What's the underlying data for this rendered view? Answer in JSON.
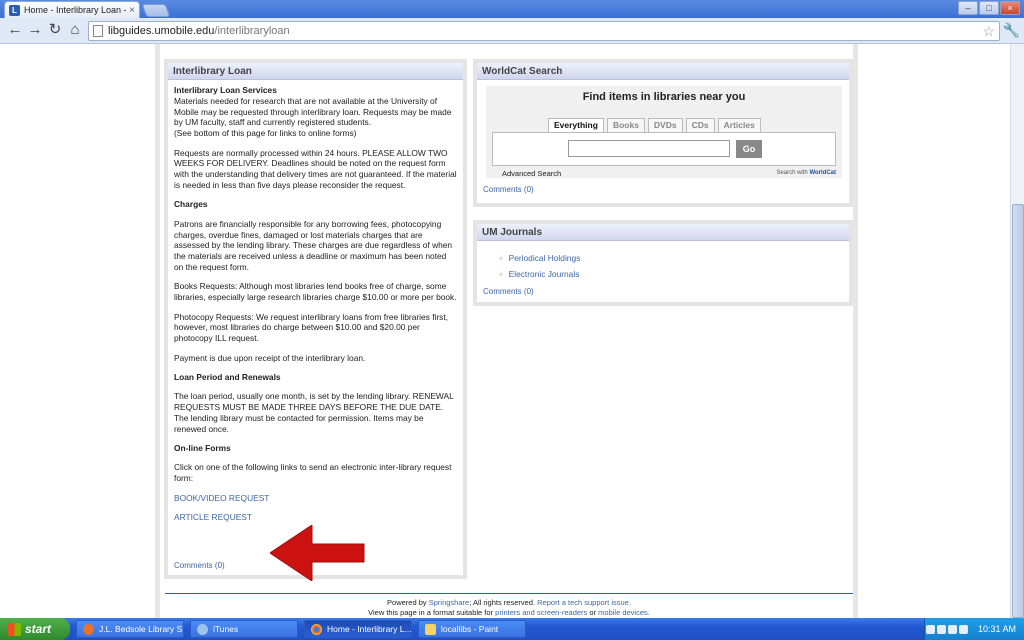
{
  "browser": {
    "tab_title": "Home - Interlibrary Loan - Lib",
    "tab_favicon": "L",
    "tab_close": "×",
    "url_host": "libguides.umobile.edu",
    "url_path": "/interlibraryloan",
    "window_buttons": {
      "minimize": "–",
      "maximize": "□",
      "close": "×"
    }
  },
  "ill": {
    "title": "Interlibrary Loan",
    "services_heading": "Interlibrary Loan Services",
    "services_text": "Materials needed for research that are not available at the University of Mobile may be requested through interlibrary loan. Requests may be made by UM faculty, staff and currently registered students.",
    "services_note": "(See bottom of this page for links to online forms)",
    "processing_text": "Requests are normally processed within 24 hours. PLEASE ALLOW TWO WEEKS FOR DELIVERY. Deadlines should be noted on the request form with the understanding that delivery times are not guaranteed. If the material is needed in less than five days please reconsider the request.",
    "charges_heading": "Charges",
    "charges_text": "Patrons are financially responsible for any borrowing fees, photocopying charges, overdue fines, damaged or lost materials charges that are assessed by the lending library. These charges are due regardless of when the materials are received unless a deadline or maximum has been noted on the request form.",
    "books_text": "Books Requests: Although most libraries lend books free of charge, some libraries, especially large research libraries charge $10.00 or more per book.",
    "photocopy_text": "Photocopy Requests: We request interlibrary loans from free libraries first, however, most libraries do charge between $10.00 and $20.00 per photocopy ILL request.",
    "payment_text": "Payment is due upon receipt of the interlibrary loan.",
    "loan_heading": "Loan Period and Renewals",
    "loan_text": "The loan period, usually one month, is set by the lending library. RENEWAL REQUESTS MUST BE MADE THREE DAYS BEFORE THE DUE DATE. The lending library must be contacted for permission. Items may be renewed once.",
    "forms_heading": "On-line Forms",
    "forms_text": "Click on one of the following links to send an electronic inter-library request form:",
    "book_link": "BOOK/VIDEO REQUEST",
    "article_link": "ARTICLE REQUEST",
    "comments": "Comments (0)"
  },
  "worldcat": {
    "title": "WorldCat Search",
    "heading": "Find items in libraries near you",
    "tabs": [
      "Everything",
      "Books",
      "DVDs",
      "CDs",
      "Articles"
    ],
    "go_label": "Go",
    "advanced": "Advanced Search",
    "brand_prefix": "Search with",
    "brand_name": "WorldCat",
    "comments": "Comments (0)"
  },
  "journals": {
    "title": "UM Journals",
    "links": [
      "Periodical Holdings",
      "Electronic Journals"
    ],
    "comments": "Comments (0)"
  },
  "footer": {
    "powered_by": "Powered by",
    "springshare": "Springshare",
    "rights": "; All rights reserved.",
    "report": "Report a tech support issue.",
    "view_prefix": "View this page in a format suitable for",
    "printers": "printers and screen-readers",
    "or": "or",
    "mobile": "mobile devices."
  },
  "taskbar": {
    "start_label": "start",
    "tasks": [
      "J.L. Bedsole Library S...",
      "iTunes",
      "Home - Interlibrary L...",
      "locallibs - Paint"
    ],
    "clock": "10:31 AM"
  },
  "colors": {
    "link": "#3b66a8",
    "arrow": "#cc1111",
    "taskbar": "#2457d1",
    "start": "#3a9a36"
  }
}
